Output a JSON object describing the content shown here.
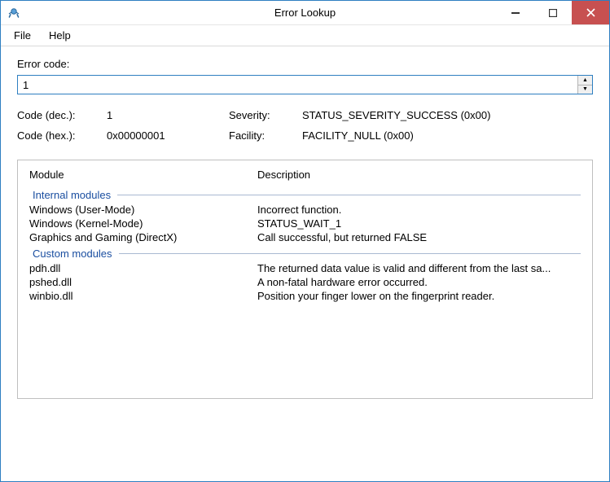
{
  "window": {
    "title": "Error Lookup"
  },
  "menu": {
    "file": "File",
    "help": "Help"
  },
  "form": {
    "error_code_label": "Error code:",
    "error_code_value": "1"
  },
  "info": {
    "code_dec_label": "Code (dec.):",
    "code_dec_value": "1",
    "severity_label": "Severity:",
    "severity_value": "STATUS_SEVERITY_SUCCESS (0x00)",
    "code_hex_label": "Code (hex.):",
    "code_hex_value": "0x00000001",
    "facility_label": "Facility:",
    "facility_value": "FACILITY_NULL (0x00)"
  },
  "results": {
    "col_module": "Module",
    "col_description": "Description",
    "section_internal": "Internal modules",
    "section_custom": "Custom modules",
    "internal": [
      {
        "module": "Windows (User-Mode)",
        "desc": "Incorrect function."
      },
      {
        "module": "Windows (Kernel-Mode)",
        "desc": "STATUS_WAIT_1"
      },
      {
        "module": "Graphics and Gaming (DirectX)",
        "desc": "Call successful, but returned FALSE"
      }
    ],
    "custom": [
      {
        "module": "pdh.dll",
        "desc": "The returned data value is valid and different from the last sa..."
      },
      {
        "module": "pshed.dll",
        "desc": "A non-fatal hardware error occurred."
      },
      {
        "module": "winbio.dll",
        "desc": "Position your finger lower on the fingerprint reader."
      }
    ]
  }
}
